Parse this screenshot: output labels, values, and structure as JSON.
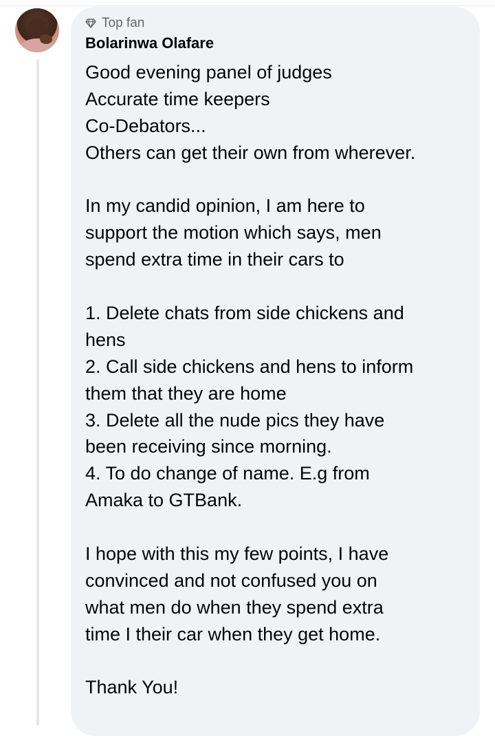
{
  "comment": {
    "badge_label": "Top fan",
    "author_name": "Bolarinwa Olafare",
    "lines": [
      "Good evening panel of judges",
      "Accurate time keepers",
      "Co-Debators...",
      "Others can get their own from wherever.",
      "",
      "In my candid opinion, I am here to",
      "support the motion which says, men",
      "spend extra time in their cars to",
      "",
      "1. Delete chats from side chickens and",
      "hens",
      "2. Call side chickens and hens to inform",
      "them that they are home",
      "3. Delete all the nude pics they have",
      "been receiving since morning.",
      "4. To do change of name. E.g from",
      "Amaka to GTBank.",
      "",
      "I hope with this my few points, I have",
      "convinced and not confused you on",
      "what men do when they spend extra",
      "time I their car when they get home.",
      "",
      "Thank You!"
    ]
  },
  "icons": {
    "badge": "diamond-icon"
  },
  "colors": {
    "bubble_background": "#f0f2f5",
    "badge_text": "#65676b",
    "text": "#050505"
  }
}
